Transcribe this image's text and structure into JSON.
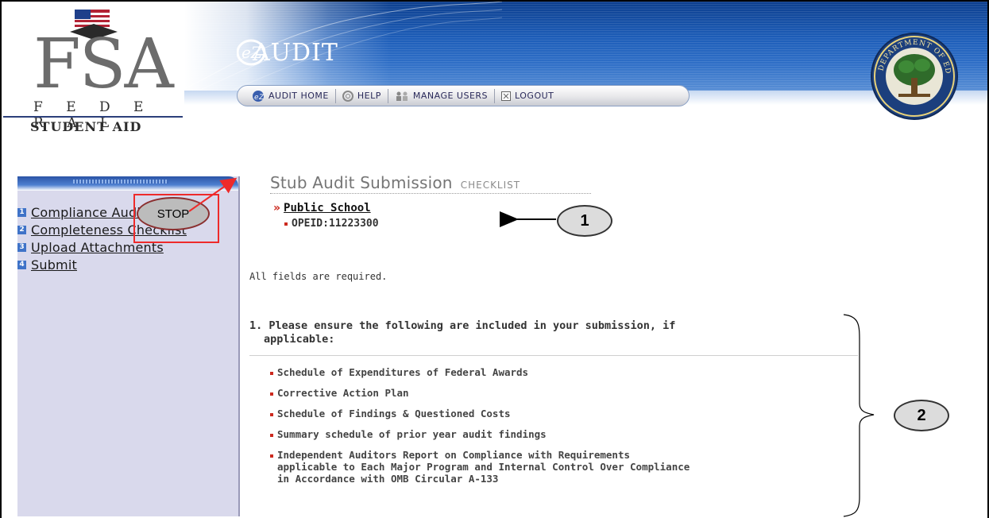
{
  "header": {
    "logo": {
      "letters": "FSA",
      "line1": "F E D E R A L",
      "line2": "STUDENT AID"
    },
    "app_title": "AUDIT",
    "app_badge": "eZ",
    "nav": [
      {
        "label": "AUDIT HOME",
        "icon": "ez-home-icon"
      },
      {
        "label": "HELP",
        "icon": "help-lifebuoy-icon"
      },
      {
        "label": "MANAGE USERS",
        "icon": "users-icon"
      },
      {
        "label": "LOGOUT",
        "icon": "logout-box-icon"
      }
    ],
    "seal_text": "DEPARTMENT OF EDUCATION · UNITED STATES OF AMERICA"
  },
  "sidebar": {
    "items": [
      {
        "num": "1",
        "label": "Compliance Audit"
      },
      {
        "num": "2",
        "label": "Completeness Checklist"
      },
      {
        "num": "3",
        "label": "Upload Attachments"
      },
      {
        "num": "4",
        "label": "Submit"
      }
    ]
  },
  "annotations": {
    "stop_label": "STOP",
    "callout_1": "1",
    "callout_2": "2"
  },
  "main": {
    "title": "Stub Audit Submission",
    "subtitle": "CHECKLIST",
    "school_name": "Public School",
    "opeid": "OPEID:11223300",
    "required_note": "All fields are required.",
    "question_line1": "1. Please ensure the following are included in your submission, if",
    "question_line2": "applicable:",
    "checklist": [
      "Schedule of Expenditures of Federal Awards",
      "Corrective Action Plan",
      "Schedule of Findings & Questioned Costs",
      "Summary schedule of prior year audit findings",
      "Independent Auditors Report on Compliance with Requirements\napplicable to Each Major Program and Internal Control Over Compliance\nin Accordance with OMB Circular A-133"
    ]
  },
  "colors": {
    "header_blue": "#1d5db8",
    "sidebar_bg": "#d9d9ec",
    "accent_red": "#cc2a1f",
    "annotation_red": "#ee2a2a"
  }
}
